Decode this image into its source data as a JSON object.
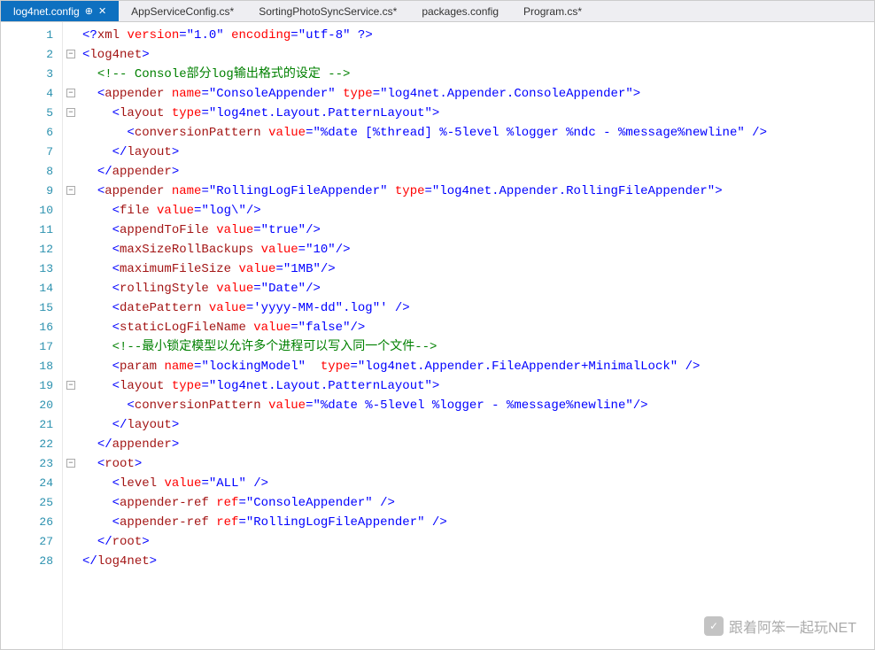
{
  "tabs": [
    {
      "label": "log4net.config",
      "active": true,
      "pinned": true
    },
    {
      "label": "AppServiceConfig.cs*",
      "active": false
    },
    {
      "label": "SortingPhotoSyncService.cs*",
      "active": false
    },
    {
      "label": "packages.config",
      "active": false
    },
    {
      "label": "Program.cs*",
      "active": false
    }
  ],
  "lineNumbers": [
    "1",
    "2",
    "3",
    "4",
    "5",
    "6",
    "7",
    "8",
    "9",
    "10",
    "11",
    "12",
    "13",
    "14",
    "15",
    "16",
    "17",
    "18",
    "19",
    "20",
    "21",
    "22",
    "23",
    "24",
    "25",
    "26",
    "27",
    "28"
  ],
  "fold": [
    "",
    "-",
    "",
    "-",
    "-",
    "",
    "",
    "",
    "-",
    "",
    "",
    "",
    "",
    "",
    "",
    "",
    "",
    "",
    "-",
    "",
    "",
    "",
    "-",
    "",
    "",
    "",
    "",
    ""
  ],
  "code": {
    "l1": {
      "pre": "<?",
      "n": "xml",
      "a1": "version",
      "v1": "\"1.0\"",
      "a2": "encoding",
      "v2": "\"utf-8\"",
      "post": " ?>"
    },
    "l2": {
      "pre": "<",
      "n": "log4net",
      "post": ">"
    },
    "l3": {
      "c": "<!-- Console部分log输出格式的设定 -->"
    },
    "l4": {
      "pre": "<",
      "n": "appender",
      "a1": "name",
      "v1": "\"ConsoleAppender\"",
      "a2": "type",
      "v2": "\"log4net.Appender.ConsoleAppender\"",
      "post": ">"
    },
    "l5": {
      "pre": "<",
      "n": "layout",
      "a1": "type",
      "v1": "\"log4net.Layout.PatternLayout\"",
      "post": ">"
    },
    "l6": {
      "pre": "<",
      "n": "conversionPattern",
      "a1": "value",
      "v1": "\"%date [%thread] %-5level %logger %ndc - %message%newline\"",
      "post": " />"
    },
    "l7": {
      "pre": "</",
      "n": "layout",
      "post": ">"
    },
    "l8": {
      "pre": "</",
      "n": "appender",
      "post": ">"
    },
    "l9": {
      "pre": "<",
      "n": "appender",
      "a1": "name",
      "v1": "\"RollingLogFileAppender\"",
      "a2": "type",
      "v2": "\"log4net.Appender.RollingFileAppender\"",
      "post": ">"
    },
    "l10": {
      "pre": "<",
      "n": "file",
      "a1": "value",
      "v1": "\"log\\\"",
      "post": "/>"
    },
    "l11": {
      "pre": "<",
      "n": "appendToFile",
      "a1": "value",
      "v1": "\"true\"",
      "post": "/>"
    },
    "l12": {
      "pre": "<",
      "n": "maxSizeRollBackups",
      "a1": "value",
      "v1": "\"10\"",
      "post": "/>"
    },
    "l13": {
      "pre": "<",
      "n": "maximumFileSize",
      "a1": "value",
      "v1": "\"1MB\"",
      "post": "/>"
    },
    "l14": {
      "pre": "<",
      "n": "rollingStyle",
      "a1": "value",
      "v1": "\"Date\"",
      "post": "/>"
    },
    "l15": {
      "pre": "<",
      "n": "datePattern",
      "a1": "value",
      "v1": "'yyyy-MM-dd\".log\"'",
      "post": " />"
    },
    "l16": {
      "pre": "<",
      "n": "staticLogFileName",
      "a1": "value",
      "v1": "\"false\"",
      "post": "/>"
    },
    "l17": {
      "c": "<!--最小锁定模型以允许多个进程可以写入同一个文件-->"
    },
    "l18": {
      "pre": "<",
      "n": "param",
      "a1": "name",
      "v1": "\"lockingModel\"",
      "a2": "type",
      "v2": "\"log4net.Appender.FileAppender+MinimalLock\"",
      "post": " />"
    },
    "l19": {
      "pre": "<",
      "n": "layout",
      "a1": "type",
      "v1": "\"log4net.Layout.PatternLayout\"",
      "post": ">"
    },
    "l20": {
      "pre": "<",
      "n": "conversionPattern",
      "a1": "value",
      "v1": "\"%date %-5level %logger - %message%newline\"",
      "post": "/>"
    },
    "l21": {
      "pre": "</",
      "n": "layout",
      "post": ">"
    },
    "l22": {
      "pre": "</",
      "n": "appender",
      "post": ">"
    },
    "l23": {
      "pre": "<",
      "n": "root",
      "post": ">"
    },
    "l24": {
      "pre": "<",
      "n": "level",
      "a1": "value",
      "v1": "\"ALL\"",
      "post": " />"
    },
    "l25": {
      "pre": "<",
      "n": "appender-ref",
      "a1": "ref",
      "v1": "\"ConsoleAppender\"",
      "post": " />"
    },
    "l26": {
      "pre": "<",
      "n": "appender-ref",
      "a1": "ref",
      "v1": "\"RollingLogFileAppender\"",
      "post": " />"
    },
    "l27": {
      "pre": "</",
      "n": "root",
      "post": ">"
    },
    "l28": {
      "pre": "</",
      "n": "log4net",
      "post": ">"
    }
  },
  "indent": {
    "l1": "",
    "l2": "",
    "l3": "  ",
    "l4": "  ",
    "l5": "    ",
    "l6": "      ",
    "l7": "    ",
    "l8": "  ",
    "l9": "  ",
    "l10": "    ",
    "l11": "    ",
    "l12": "    ",
    "l13": "    ",
    "l14": "    ",
    "l15": "    ",
    "l16": "    ",
    "l17": "    ",
    "l18": "    ",
    "l19": "    ",
    "l20": "      ",
    "l21": "    ",
    "l22": "  ",
    "l23": "  ",
    "l24": "    ",
    "l25": "    ",
    "l26": "    ",
    "l27": "  ",
    "l28": ""
  },
  "watermark": {
    "text": "跟着阿笨一起玩NET",
    "icon": "✓"
  }
}
